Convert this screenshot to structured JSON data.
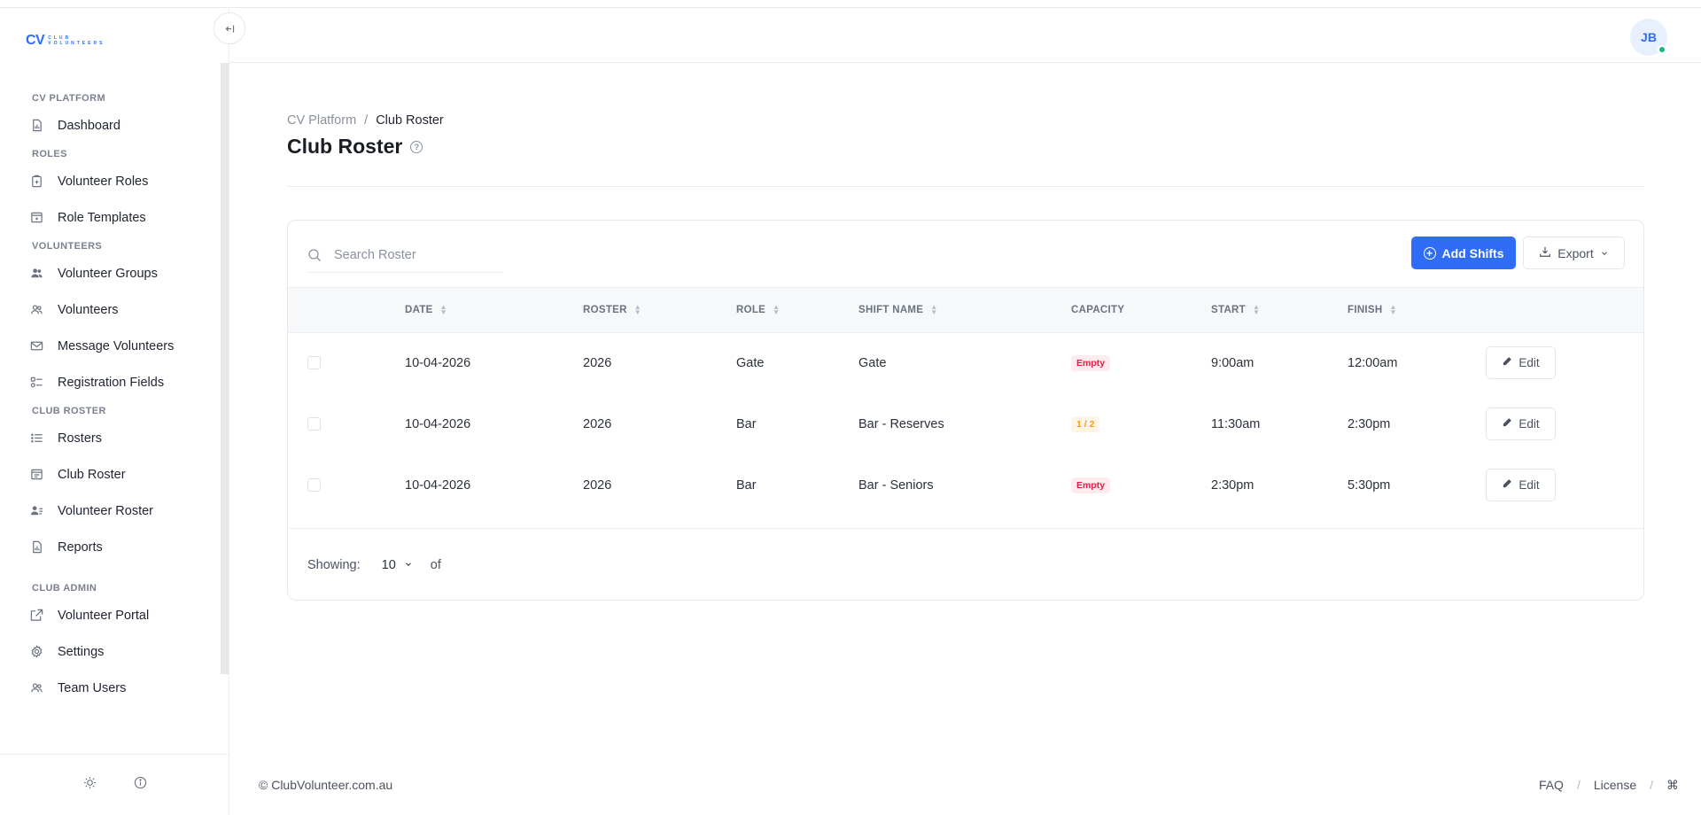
{
  "brand": {
    "logo_main": "CV",
    "logo_line1": "CLUB",
    "logo_line2": "VOLUNTEERS"
  },
  "sidebar": {
    "sections": [
      {
        "label": "CV PLATFORM",
        "items": [
          {
            "label": "Dashboard",
            "icon": "dashboard-icon"
          }
        ]
      },
      {
        "label": "ROLES",
        "items": [
          {
            "label": "Volunteer Roles",
            "icon": "clipboard-icon"
          },
          {
            "label": "Role Templates",
            "icon": "template-icon"
          }
        ]
      },
      {
        "label": "VOLUNTEERS",
        "items": [
          {
            "label": "Volunteer Groups",
            "icon": "users-icon"
          },
          {
            "label": "Volunteers",
            "icon": "user-group-icon"
          },
          {
            "label": "Message Volunteers",
            "icon": "mail-icon"
          },
          {
            "label": "Registration Fields",
            "icon": "form-fields-icon"
          }
        ]
      },
      {
        "label": "CLUB ROSTER",
        "items": [
          {
            "label": "Rosters",
            "icon": "list-icon"
          },
          {
            "label": "Club Roster",
            "icon": "calendar-icon"
          },
          {
            "label": "Volunteer Roster",
            "icon": "user-list-icon"
          },
          {
            "label": "Reports",
            "icon": "report-icon"
          }
        ]
      },
      {
        "label": "CLUB ADMIN",
        "items": [
          {
            "label": "Volunteer Portal",
            "icon": "external-link-icon"
          },
          {
            "label": "Settings",
            "icon": "gear-icon"
          },
          {
            "label": "Team Users",
            "icon": "team-icon"
          }
        ]
      }
    ]
  },
  "header": {
    "avatar_initials": "JB"
  },
  "breadcrumb": {
    "root": "CV Platform",
    "separator": "/",
    "current": "Club Roster"
  },
  "page": {
    "title": "Club Roster",
    "help_glyph": "?"
  },
  "toolbar": {
    "search_placeholder": "Search Roster",
    "add_label": "Add Shifts",
    "export_label": "Export"
  },
  "table": {
    "columns": [
      "DATE",
      "ROSTER",
      "ROLE",
      "SHIFT NAME",
      "CAPACITY",
      "START",
      "FINISH"
    ],
    "rows": [
      {
        "date": "10-04-2026",
        "roster": "2026",
        "role": "Gate",
        "shift": "Gate",
        "capacity": "Empty",
        "start": "9:00am",
        "finish": "12:00am",
        "edit": "Edit"
      },
      {
        "date": "10-04-2026",
        "roster": "2026",
        "role": "Bar",
        "shift": "Bar - Reserves",
        "capacity": "1 / 2",
        "start": "11:30am",
        "finish": "2:30pm",
        "edit": "Edit"
      },
      {
        "date": "10-04-2026",
        "roster": "2026",
        "role": "Bar",
        "shift": "Bar - Seniors",
        "capacity": "Empty",
        "start": "2:30pm",
        "finish": "5:30pm",
        "edit": "Edit"
      }
    ],
    "footer": {
      "showing_label": "Showing:",
      "per_page": "10",
      "of_label": "of"
    }
  },
  "footer": {
    "copyright": "© ClubVolunteer.com.au",
    "faq": "FAQ",
    "license": "License",
    "sep": "/",
    "cmd_glyph": "⌘"
  },
  "colors": {
    "accent": "#2f6df6",
    "empty_badge": "#e11d48",
    "partial_badge": "#f59e0b",
    "online": "#10b981"
  }
}
